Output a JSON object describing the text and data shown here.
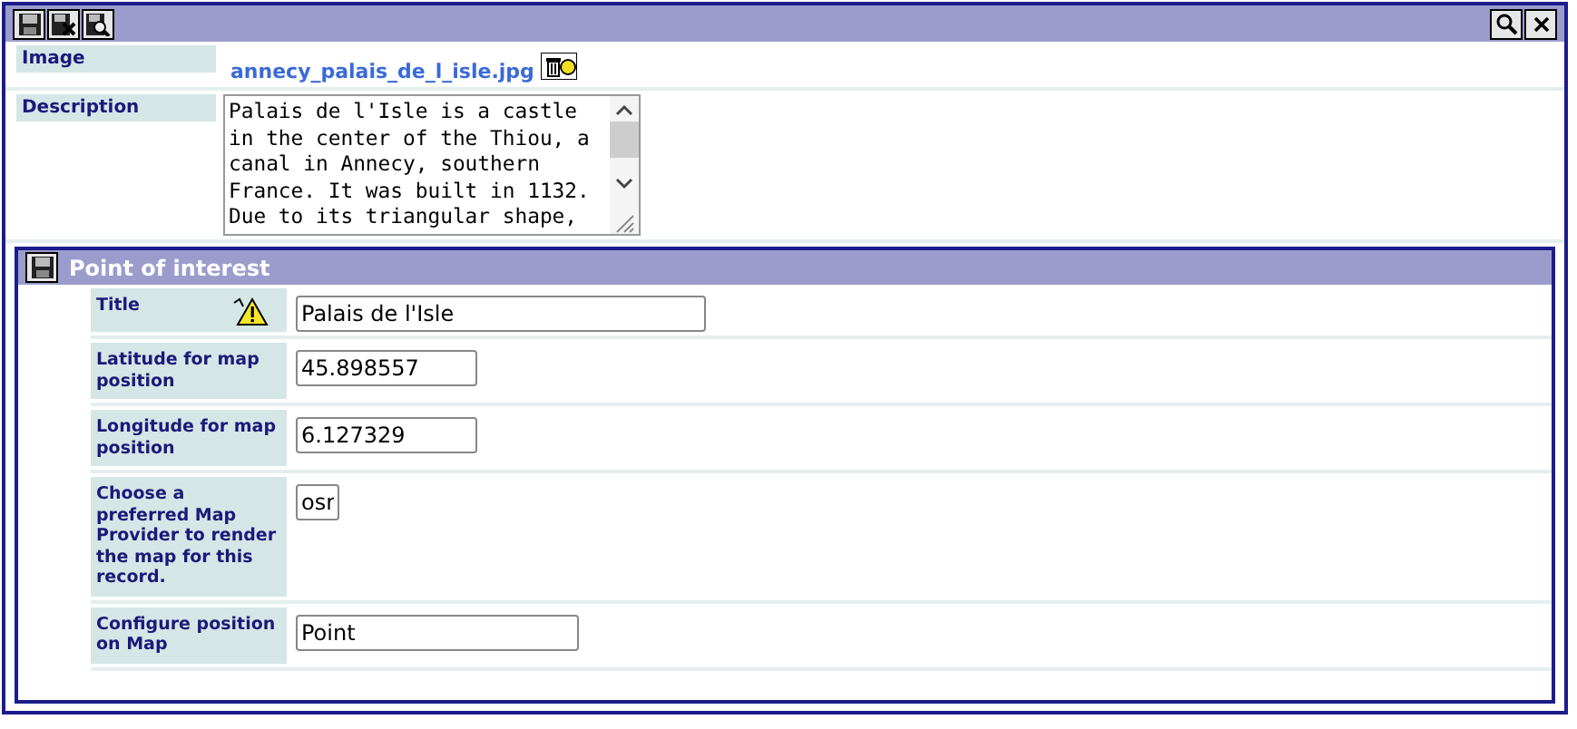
{
  "toolbar": {
    "left_buttons": [
      {
        "kind": "save"
      },
      {
        "kind": "save-close"
      },
      {
        "kind": "save-preview"
      }
    ],
    "right_buttons": [
      {
        "kind": "search"
      },
      {
        "kind": "close"
      }
    ]
  },
  "image": {
    "label": "Image",
    "file": "annecy_palais_de_l_isle.jpg"
  },
  "description": {
    "label": "Description",
    "value": "Palais de l'Isle is a castle in the center of the Thiou, a canal in Annecy, southern France. It was built in 1132. Due to its triangular shape,"
  },
  "section": {
    "title": "Point of interest",
    "rows": [
      {
        "label": "Title",
        "value": "Palais de l'Isle",
        "warning": true
      },
      {
        "label": "Latitude for map position",
        "value": "45.898557",
        "warning": false
      },
      {
        "label": "Longitude for map position",
        "value": "6.127329",
        "warning": false
      },
      {
        "label": "Choose a preferred Map Provider to render the map for this record.",
        "value": "osr",
        "warning": false
      },
      {
        "label": "Configure position on Map",
        "value": "Point",
        "warning": false
      }
    ]
  }
}
